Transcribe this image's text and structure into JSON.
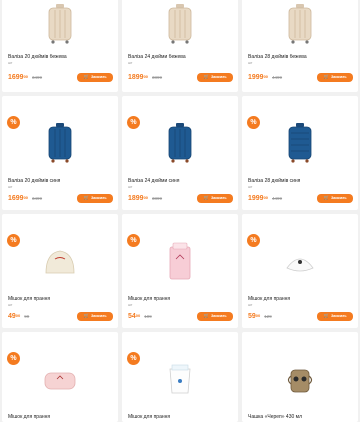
{
  "badge_symbol": "%",
  "buy_label": "Заказать",
  "unit_label": "шт",
  "accent_color": "#f47b20",
  "products": [
    {
      "title": "Валіза 20 дюймів бежева",
      "price": "1699",
      "cents": "00",
      "old": "3499",
      "kind": "suitcase-beige"
    },
    {
      "title": "Валіза 24 дюйми бежева",
      "price": "1899",
      "cents": "00",
      "old": "3899",
      "kind": "suitcase-beige"
    },
    {
      "title": "Валіза 28 дюймів бежева",
      "price": "1999",
      "cents": "00",
      "old": "4499",
      "kind": "suitcase-beige"
    },
    {
      "title": "Валіза 20 дюймів синя",
      "price": "1699",
      "cents": "00",
      "old": "3499",
      "kind": "suitcase-blue"
    },
    {
      "title": "Валіза 24 дюйми синя",
      "price": "1899",
      "cents": "00",
      "old": "3899",
      "kind": "suitcase-blue"
    },
    {
      "title": "Валіза 28 дюймів синя",
      "price": "1999",
      "cents": "00",
      "old": "4499",
      "kind": "suitcase-blue"
    },
    {
      "title": "Мішок для прання",
      "price": "49",
      "cents": "00",
      "old": "99",
      "kind": "laundry-bag"
    },
    {
      "title": "Мішок для прання",
      "price": "54",
      "cents": "00",
      "old": "109",
      "kind": "laundry-bag-pink"
    },
    {
      "title": "Мішок для прання",
      "price": "59",
      "cents": "00",
      "old": "129",
      "kind": "laundry-bag-white"
    },
    {
      "title": "Мішок для прання",
      "price": "",
      "cents": "",
      "old": "",
      "kind": "laundry-pink-box"
    },
    {
      "title": "Мішок для прання",
      "price": "",
      "cents": "",
      "old": "",
      "kind": "laundry-white-box"
    },
    {
      "title": "Чашка «Череп» 430 мл",
      "price": "",
      "cents": "",
      "old": "",
      "kind": "skull-mug"
    }
  ]
}
